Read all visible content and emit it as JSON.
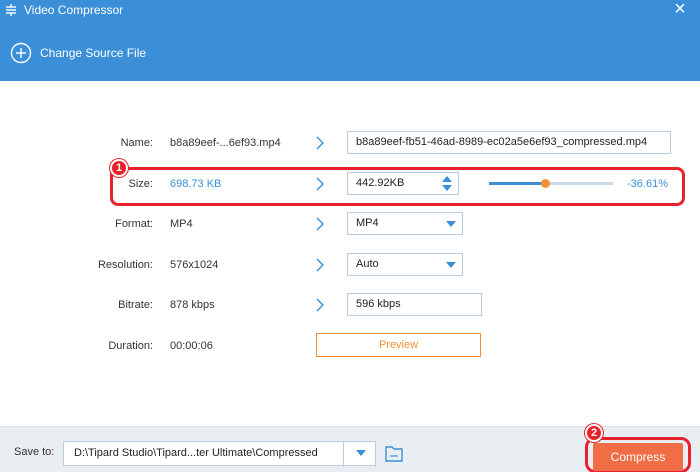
{
  "window": {
    "title": "Video Compressor",
    "close_glyph": "×"
  },
  "toolbar": {
    "change_source_label": "Change Source File"
  },
  "form": {
    "name": {
      "label": "Name:",
      "source": "b8a89eef-...6ef93.mp4",
      "target": "b8a89eef-fb51-46ad-8989-ec02a5e6ef93_compressed.mp4"
    },
    "size": {
      "label": "Size:",
      "source": "698.73 KB",
      "target": "442.92KB",
      "percent": "-36.61%",
      "slider_fraction": 0.45
    },
    "format": {
      "label": "Format:",
      "source": "MP4",
      "target": "MP4"
    },
    "resolution": {
      "label": "Resolution:",
      "source": "576x1024",
      "target": "Auto"
    },
    "bitrate": {
      "label": "Bitrate:",
      "source": "878 kbps",
      "target": "596 kbps"
    },
    "duration": {
      "label": "Duration:",
      "source": "00:00:06"
    },
    "preview_label": "Preview"
  },
  "annotations": {
    "step1": "1",
    "step2": "2"
  },
  "footer": {
    "save_label": "Save to:",
    "path": "D:\\Tipard Studio\\Tipard...ter Ultimate\\Compressed",
    "compress_label": "Compress"
  },
  "colors": {
    "accent": "#3a8fd8",
    "orange": "#f39035",
    "compress": "#f06d45",
    "highlight": "#e8212d"
  }
}
